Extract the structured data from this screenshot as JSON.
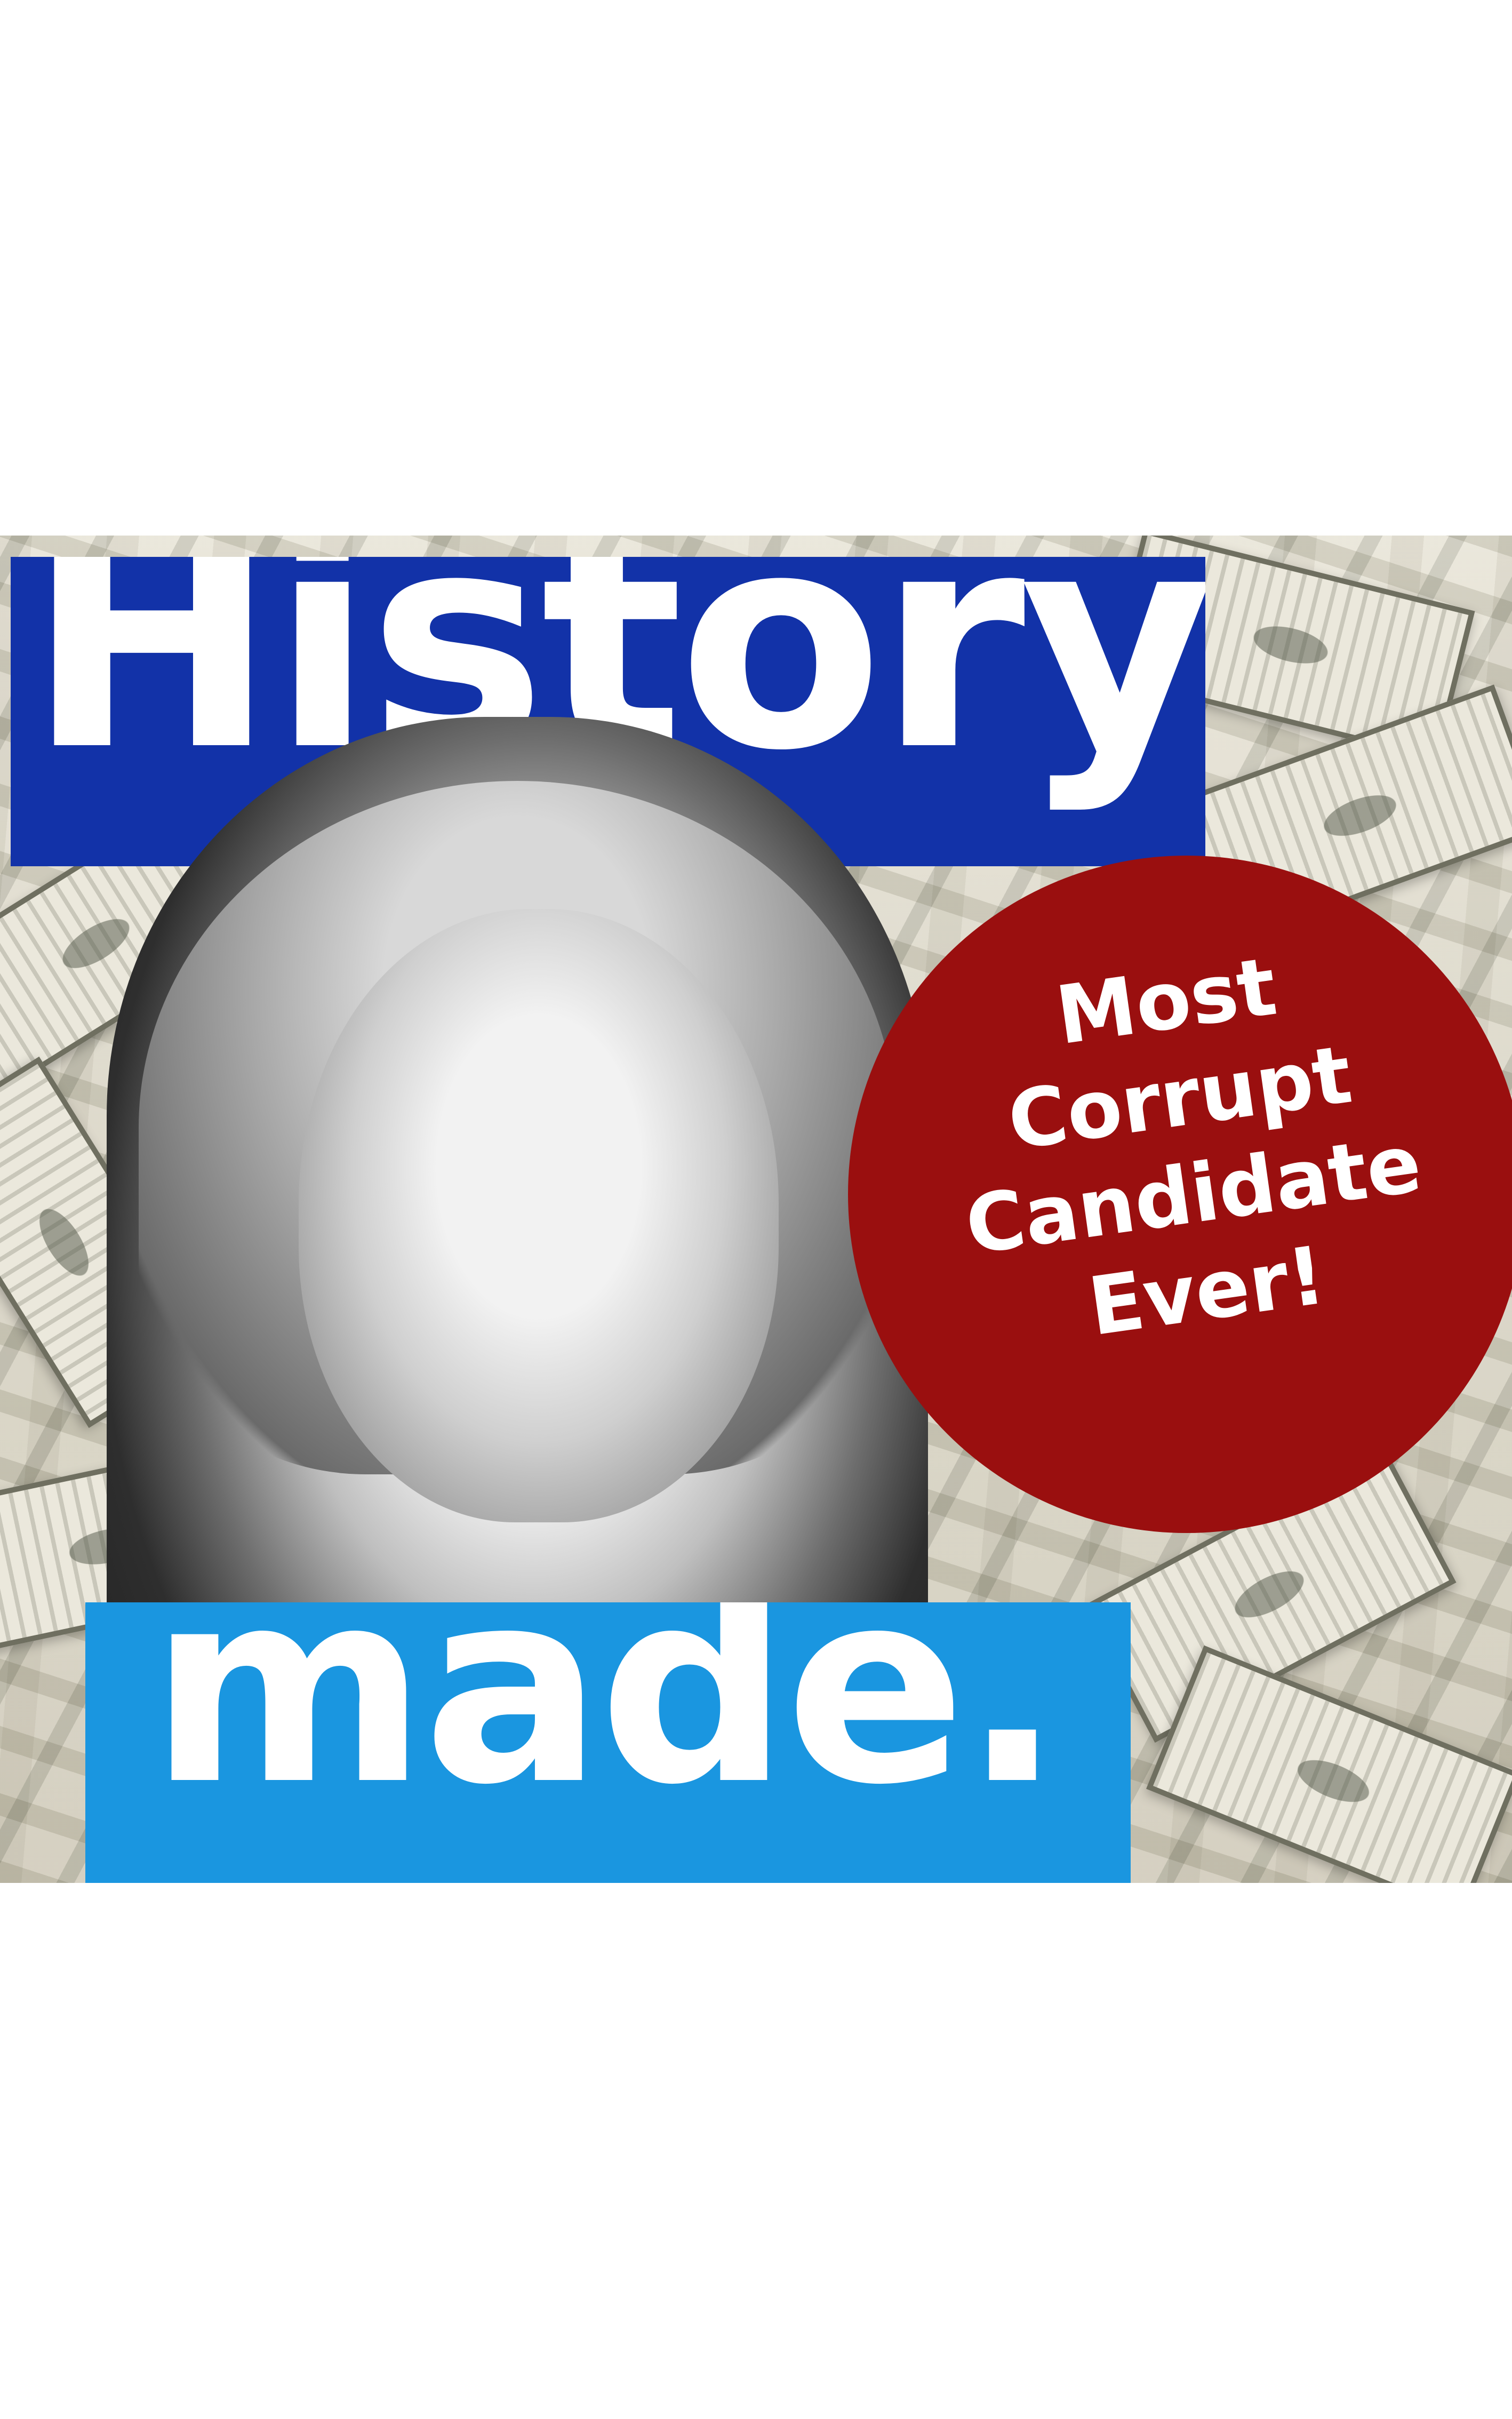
{
  "poster": {
    "title": "History",
    "footer": "made.",
    "stamp_lines": [
      "Most",
      "Corrupt",
      "Candidate",
      "Ever!"
    ]
  },
  "colors": {
    "title_box": "#1232a8",
    "footer_box": "#1a96e0",
    "stamp": "#9a0f0f",
    "text": "#ffffff"
  }
}
